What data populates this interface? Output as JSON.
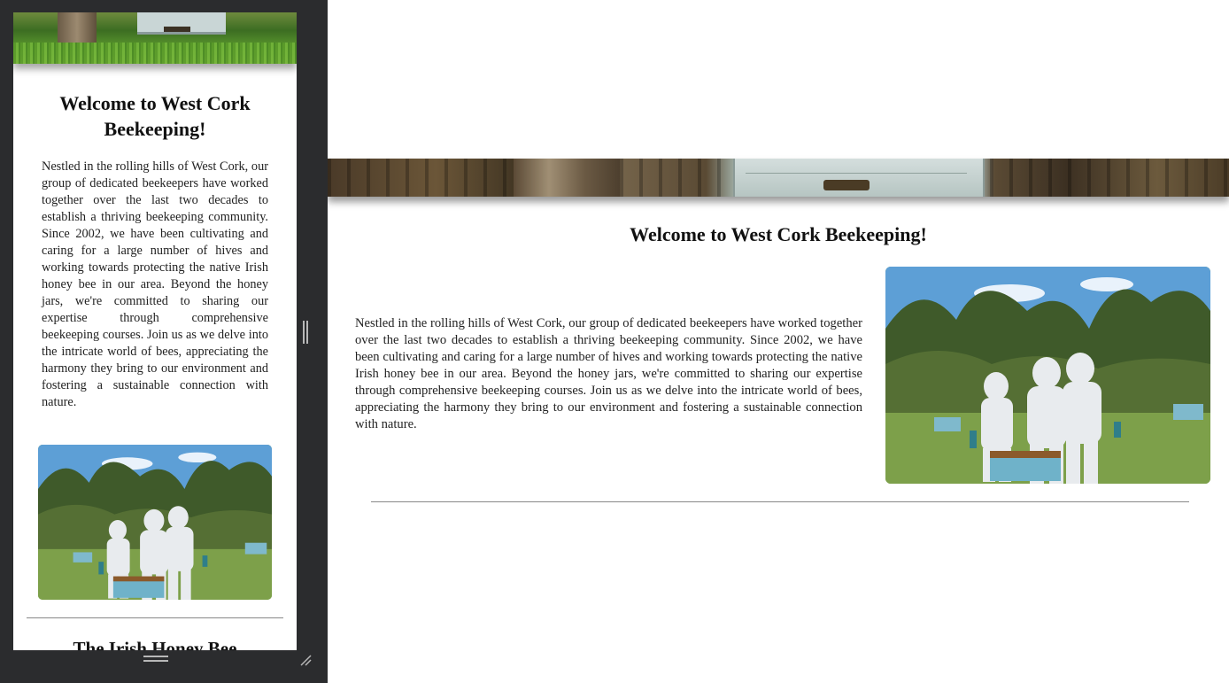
{
  "mobile": {
    "welcome_title": "Welcome to West Cork Beekeeping!",
    "intro_text": "Nestled in the rolling hills of West Cork, our group of dedicated beekeepers have worked together over the last two decades to establish a thriving beekeeping community. Since 2002, we have been cultivating and caring for a large number of hives and working towards protecting the native Irish honey bee in our area. Beyond the honey jars, we're committed to sharing our expertise through comprehensive beekeeping courses. Join us as we delve into the intricate world of bees, appreciating the harmony they bring to our environment and fostering a sustainable connection with nature.",
    "next_section_title": "The Irish Honey Bee"
  },
  "desktop": {
    "welcome_title": "Welcome to West Cork Beekeeping!",
    "intro_text": "Nestled in the rolling hills of West Cork, our group of dedicated beekeepers have worked together over the last two decades to establish a thriving beekeeping community. Since 2002, we have been cultivating and caring for a large number of hives and working towards protecting the native Irish honey bee in our area. Beyond the honey jars, we're committed to sharing our expertise through comprehensive beekeeping courses. Join us as we delve into the intricate world of bees, appreciating the harmony they bring to our environment and fostering a sustainable connection with nature."
  },
  "icons": {
    "side_handle": "vertical-resize-grip-icon",
    "bottom_handle": "horizontal-resize-grip-icon",
    "corner_handle": "corner-resize-icon"
  },
  "colors": {
    "pane_background": "#2b2c2e",
    "page_background": "#ffffff",
    "divider": "#888888",
    "suit_white": "#e8ebee",
    "hive_blue": "#8fc7d6"
  }
}
